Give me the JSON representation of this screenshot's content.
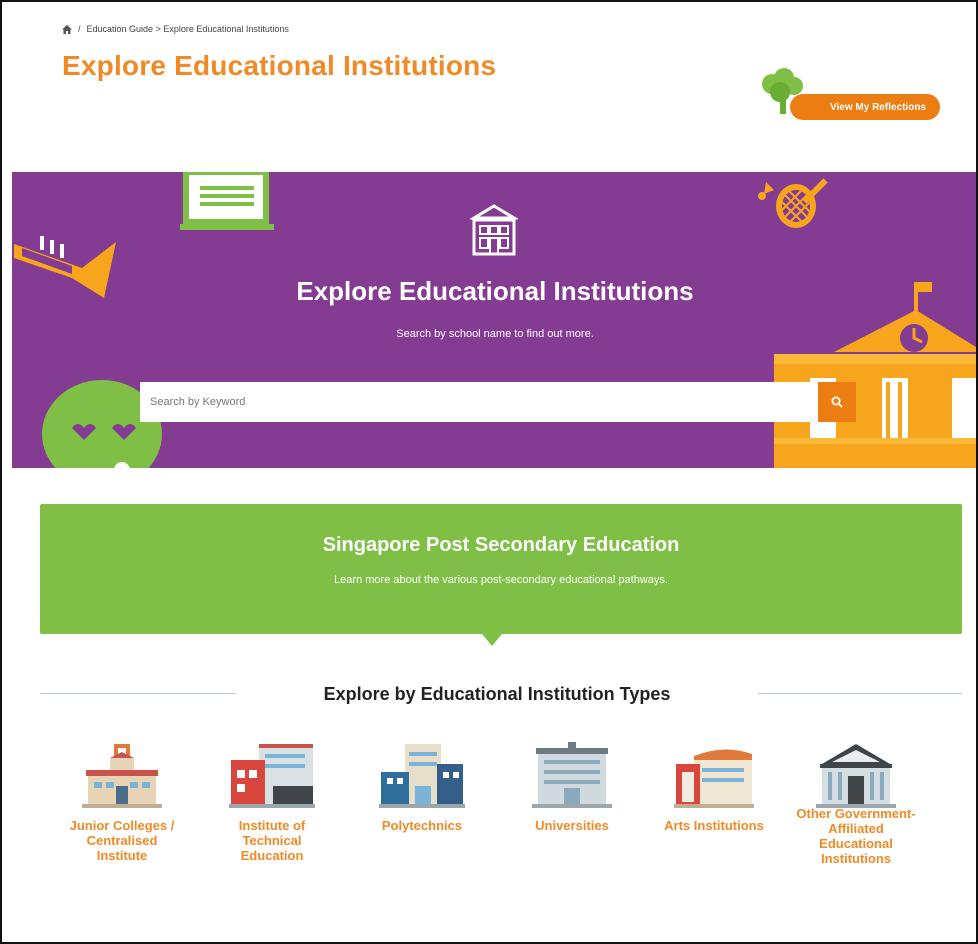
{
  "breadcrumb": {
    "home_icon": "home-icon",
    "separator": "/",
    "trail": "Education Guide > Explore Educational Institutions"
  },
  "header": {
    "title": "Explore Educational Institutions",
    "reflections_label": "View My Reflections"
  },
  "hero": {
    "title": "Explore Educational Institutions",
    "subtitle": "Search by school name to find out more.",
    "search_placeholder": "Search by Keyword",
    "search_value": "",
    "search_icon": "search-icon"
  },
  "banner": {
    "title": "Singapore Post Secondary Education",
    "description": "Learn more about the various post-secondary educational pathways."
  },
  "types_section": {
    "title": "Explore by Educational Institution Types",
    "items": [
      {
        "label": "Junior Colleges / Centralised Institute",
        "icon": "junior-college-building-icon"
      },
      {
        "label": "Institute of Technical Education",
        "icon": "ite-building-icon"
      },
      {
        "label": "Polytechnics",
        "icon": "polytechnic-building-icon"
      },
      {
        "label": "Universities",
        "icon": "university-building-icon"
      },
      {
        "label": "Arts Institutions",
        "icon": "arts-institution-building-icon"
      },
      {
        "label": "Other Government-Affiliated Educational Institutions",
        "icon": "government-building-icon"
      }
    ]
  },
  "colors": {
    "accent_orange": "#ec7d12",
    "title_orange": "#ef8a26",
    "hero_purple": "#843b92",
    "banner_green": "#7fbf45"
  }
}
